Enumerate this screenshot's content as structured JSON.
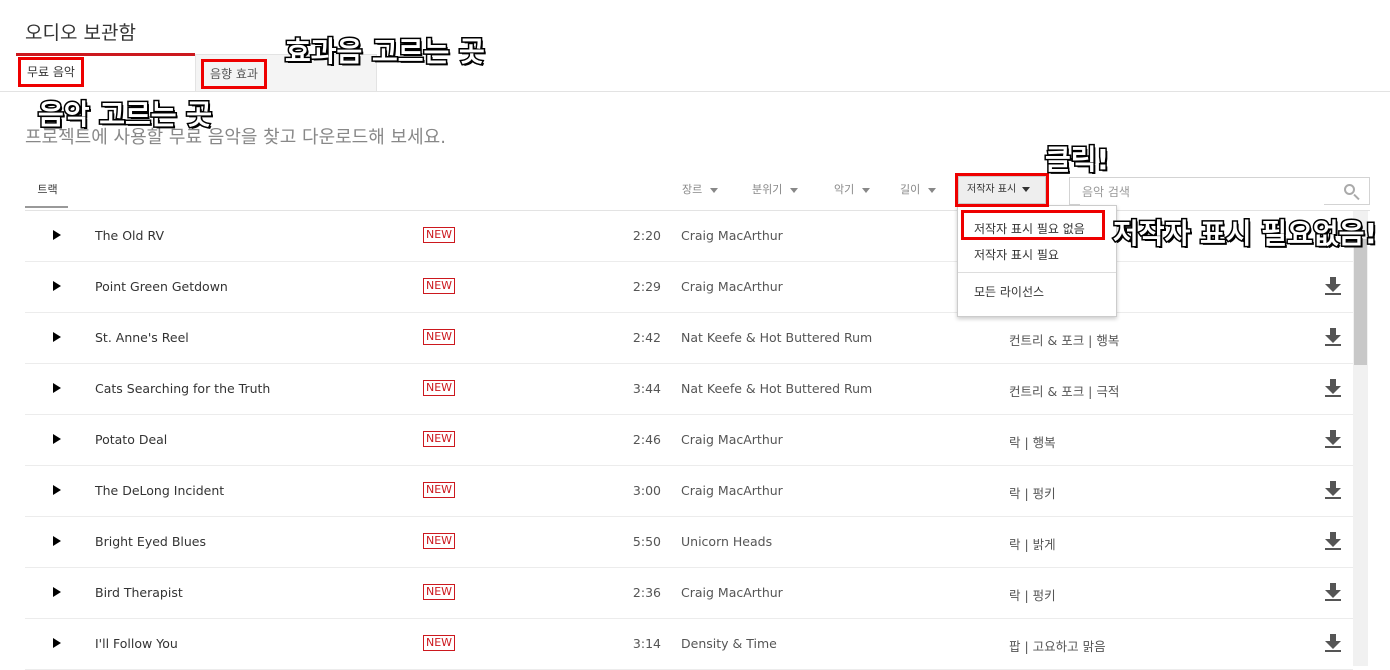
{
  "header": {
    "title": "오디오 보관함"
  },
  "tabs": [
    {
      "label": "무료 음악"
    },
    {
      "label": "음향 효과"
    }
  ],
  "subtitle": "프로젝트에 사용할 무료 음악을 찾고 다운로드해 보세요.",
  "toolbar": {
    "track_tab": "트랙",
    "filters": [
      "장르",
      "분위기",
      "악기",
      "길이"
    ],
    "attribution_label": "저작자 표시",
    "search_placeholder": "음악 검색"
  },
  "dropdown": {
    "items": [
      "저작자 표시 필요 없음",
      "저작자 표시 필요",
      "모든 라이선스"
    ]
  },
  "badge": "NEW",
  "tracks": [
    {
      "title": "The Old RV",
      "duration": "2:20",
      "artist": "Craig MacArthur",
      "genre": ""
    },
    {
      "title": "Point Green Getdown",
      "duration": "2:29",
      "artist": "Craig MacArthur",
      "genre": ""
    },
    {
      "title": "St. Anne's Reel",
      "duration": "2:42",
      "artist": "Nat Keefe & Hot Buttered Rum",
      "genre": "컨트리 & 포크 | 행복"
    },
    {
      "title": "Cats Searching for the Truth",
      "duration": "3:44",
      "artist": "Nat Keefe & Hot Buttered Rum",
      "genre": "컨트리 & 포크 | 극적"
    },
    {
      "title": "Potato Deal",
      "duration": "2:46",
      "artist": "Craig MacArthur",
      "genre": "락 | 행복"
    },
    {
      "title": "The DeLong Incident",
      "duration": "3:00",
      "artist": "Craig MacArthur",
      "genre": "락 | 펑키"
    },
    {
      "title": "Bright Eyed Blues",
      "duration": "5:50",
      "artist": "Unicorn Heads",
      "genre": "락 | 밝게"
    },
    {
      "title": "Bird Therapist",
      "duration": "2:36",
      "artist": "Craig MacArthur",
      "genre": "락 | 펑키"
    },
    {
      "title": "I'll Follow You",
      "duration": "3:14",
      "artist": "Density & Time",
      "genre": "팝 | 고요하고 맑음"
    }
  ],
  "annotations": {
    "sfx": "효과음 고르는 곳",
    "music": "음악 고르는 곳",
    "click": "클릭!",
    "attribution": "저작자 표시 필요없음!"
  }
}
